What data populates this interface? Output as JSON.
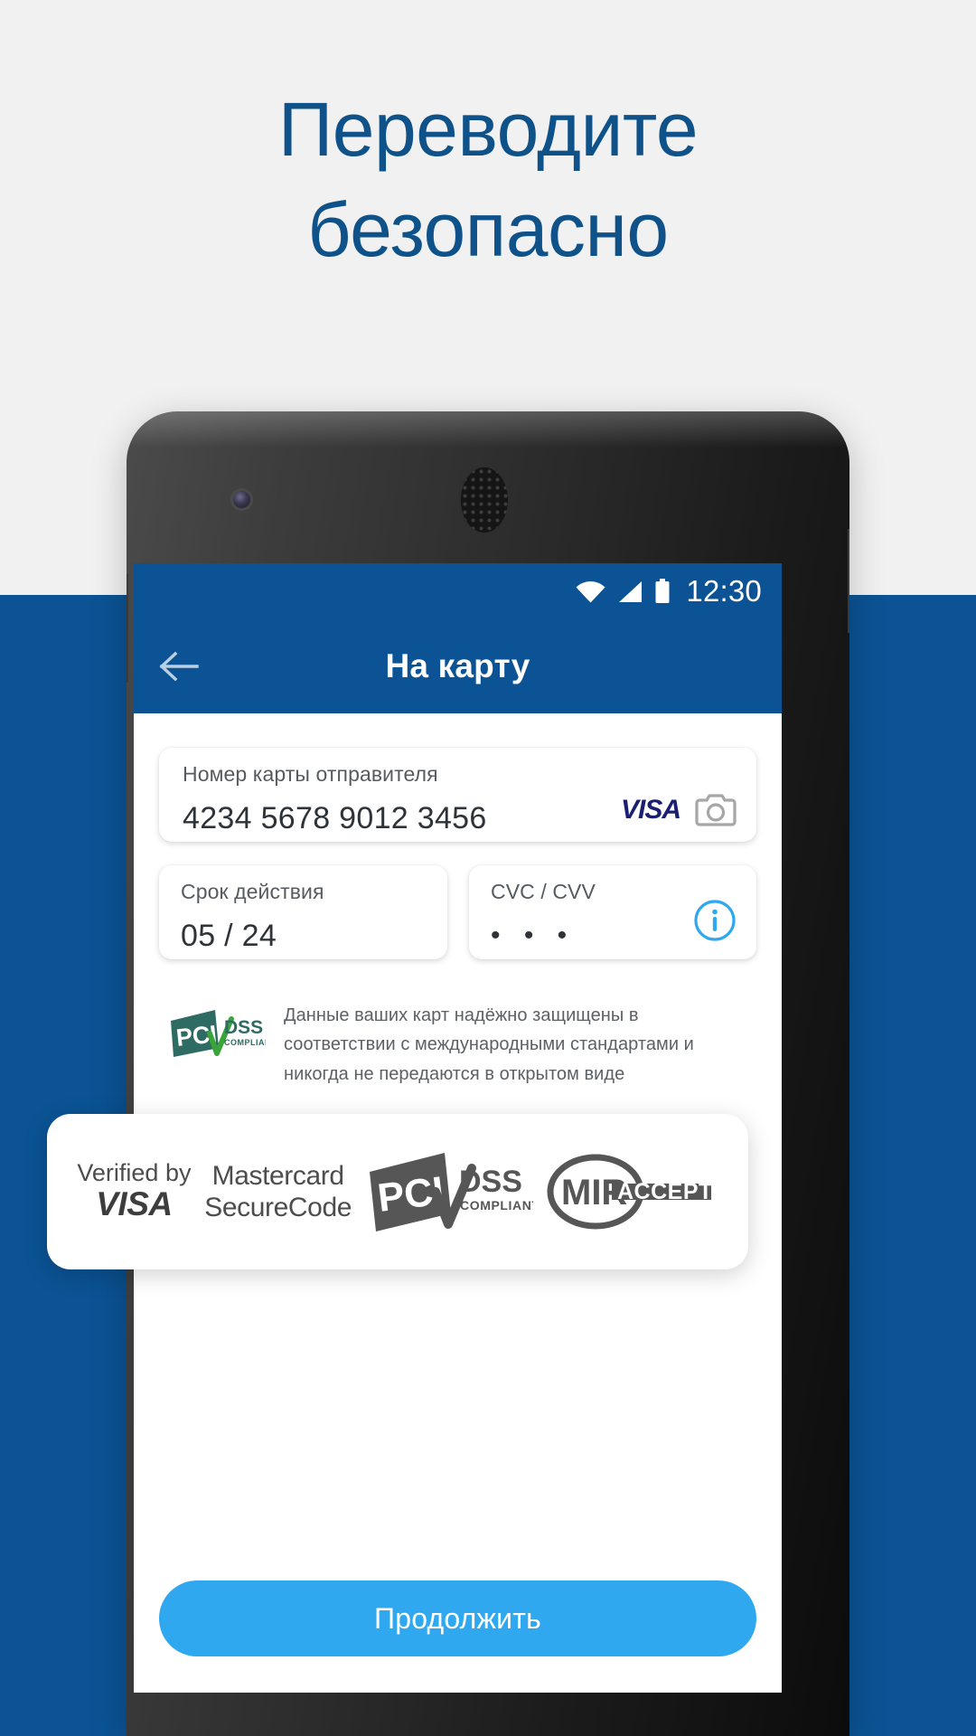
{
  "headline": {
    "line1": "Переводите",
    "line2": "безопасно",
    "color": "#0f5289"
  },
  "background": {
    "light": "#f1f1f1",
    "blue_band": "#0b5394"
  },
  "phone": {
    "camera_icon": "front-camera",
    "speaker_icon": "earpiece-speaker"
  },
  "statusbar": {
    "wifi_icon": "wifi-icon",
    "signal_icon": "cellular-signal-icon",
    "battery_icon": "battery-full-icon",
    "time": "12:30",
    "background": "#0b5394"
  },
  "appbar": {
    "back_icon": "back-arrow-icon",
    "title": "На карту",
    "background": "#0b5394"
  },
  "form": {
    "card_number": {
      "label": "Номер карты отправителя",
      "value": "4234 5678 9012 3456",
      "brand_logo": "VISA",
      "scan_icon": "camera-icon"
    },
    "expiry": {
      "label": "Срок действия",
      "value": "05 / 24"
    },
    "cvc": {
      "label": "CVC / CVV",
      "value": "• • •",
      "info_icon": "info-circle-icon",
      "info_icon_color": "#2fa8ef"
    }
  },
  "pci_notice": {
    "badge_icon": "pci-dss-compliant-badge",
    "badge_text_main": "PCI",
    "badge_text_dss": "DSS",
    "badge_text_compliant": "COMPLIANT",
    "text": "Данные ваших карт надёжно защищены в соответствии с международными стандартами и никогда не передаются в открытом виде"
  },
  "continue_button": {
    "label": "Продолжить",
    "background": "#2fa8ef",
    "text_color": "#ffffff"
  },
  "trust_badges": [
    {
      "name": "verified-by-visa",
      "line1": "Verified by",
      "line2": "VISA"
    },
    {
      "name": "mastercard-securecode",
      "line1": "Mastercard",
      "line2": "SecureCode"
    },
    {
      "name": "pci-dss-compliant",
      "line1": "PCI",
      "line2": "DSS",
      "line3": "COMPLIANT"
    },
    {
      "name": "mir-accept",
      "line1": "MIR",
      "line2": "ACCEPT"
    }
  ]
}
